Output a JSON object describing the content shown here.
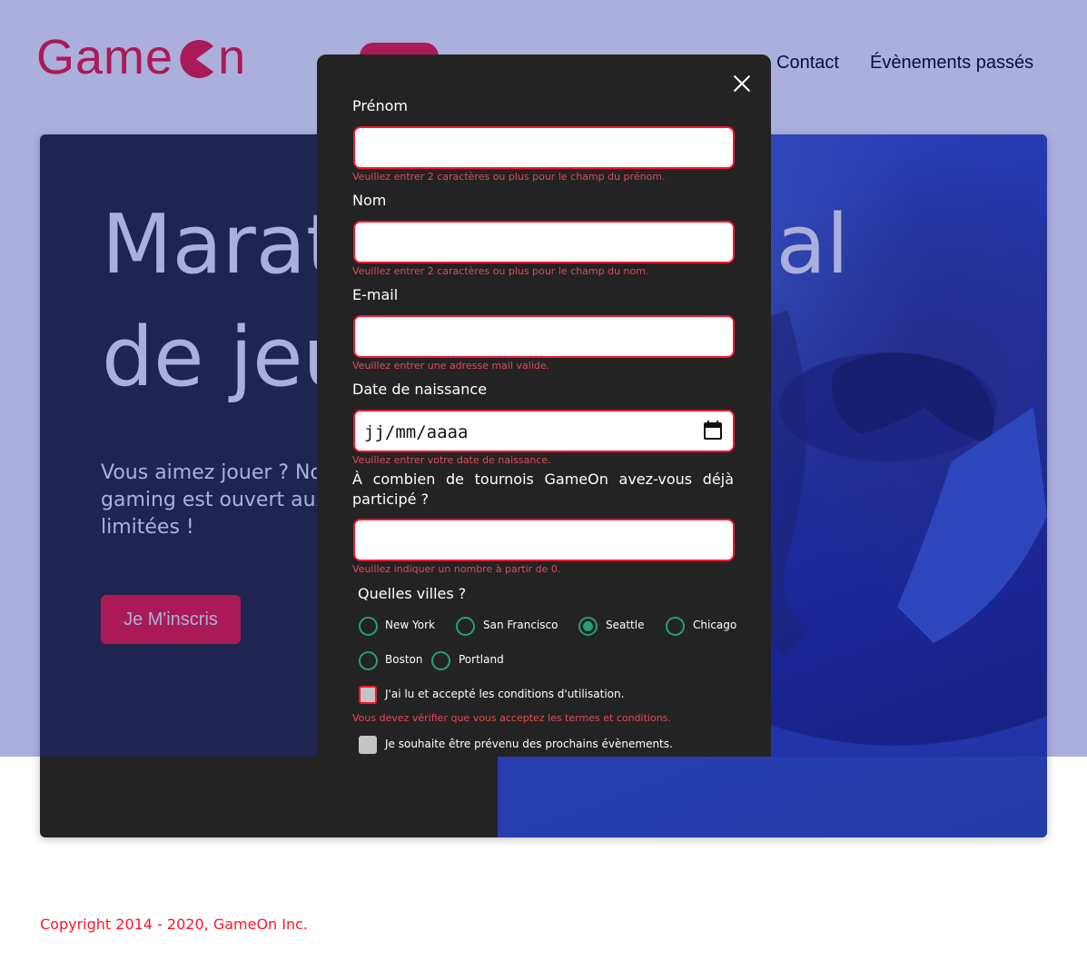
{
  "brand": {
    "name_left": "Game",
    "name_right": "n",
    "color": "#fe142f"
  },
  "nav": {
    "items": [
      "Contact",
      "Évènements passés"
    ]
  },
  "hero": {
    "title_line1": "Marathon national",
    "title_line2": "de jeux vidéos",
    "subtitle": "Vous aimez jouer ? Notre prochain évènement gaming est ouvert aux réservations... Places limitées !",
    "cta_label": "Je M'inscris"
  },
  "modal": {
    "close_icon": "close-icon",
    "fields": {
      "first": {
        "label": "Prénom",
        "value": "",
        "error": "Veuillez entrer 2 caractères ou plus pour le champ du prénom."
      },
      "last": {
        "label": "Nom",
        "value": "",
        "error": "Veuillez entrer 2 caractères ou plus pour le champ du nom."
      },
      "email": {
        "label": "E-mail",
        "value": "",
        "error": "Veuillez entrer une adresse mail valide."
      },
      "birthdate": {
        "label": "Date de naissance",
        "placeholder": "jj/mm/aaaa",
        "error": "Veuillez entrer votre date de naissance."
      },
      "quantity": {
        "label": "À combien de tournois GameOn avez-vous déjà participé ?",
        "value": "",
        "error": "Veuillez indiquer un nombre à partir de 0."
      }
    },
    "cities": {
      "label": "Quelles villes ?",
      "options": [
        "New York",
        "San Francisco",
        "Seattle",
        "Chicago",
        "Boston",
        "Portland"
      ],
      "selected": "Seattle"
    },
    "terms": {
      "label": "J'ai lu et accepté les conditions d'utilisation.",
      "error": "Vous devez vérifier que vous acceptez les termes et conditions."
    },
    "newsletter": {
      "label": "Je souhaite être prévenu des prochains évènements."
    }
  },
  "footer": {
    "copyright": "Copyright 2014 - 2020, GameOn Inc."
  },
  "colors": {
    "accent": "#fe142f",
    "radio": "#279e7a",
    "modal_bg": "#232323",
    "overlay": "#1a279c"
  }
}
